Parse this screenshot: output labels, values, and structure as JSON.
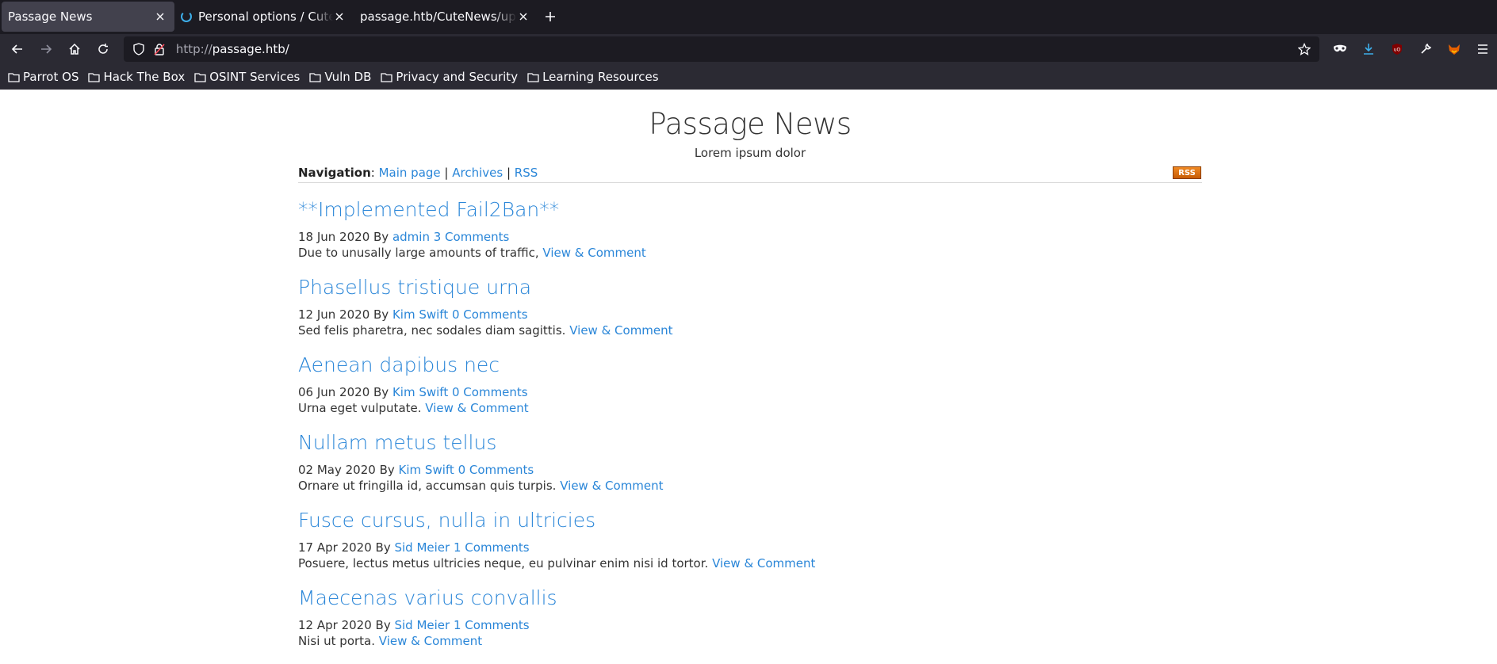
{
  "tabs": [
    {
      "title": "Passage News",
      "active": true
    },
    {
      "title": "Personal options / CuteNews",
      "loading": true
    },
    {
      "title": "passage.htb/CuteNews/uploads"
    }
  ],
  "url": {
    "scheme": "http://",
    "host": "passage.htb/"
  },
  "bookmarks": [
    "Parrot OS",
    "Hack The Box",
    "OSINT Services",
    "Vuln DB",
    "Privacy and Security",
    "Learning Resources"
  ],
  "site": {
    "title": "Passage News",
    "subtitle": "Lorem ipsum dolor"
  },
  "nav": {
    "label": "Navigation",
    "links": [
      "Main page",
      "Archives",
      "RSS"
    ],
    "rss_badge": "RSS"
  },
  "posts": [
    {
      "title": "**Implemented Fail2Ban**",
      "date": "18 Jun 2020",
      "by": "By",
      "author": "admin",
      "comments": "3 Comments",
      "excerpt": "Due to unusally large amounts of traffic,",
      "link": "View & Comment"
    },
    {
      "title": "Phasellus tristique urna",
      "date": "12 Jun 2020",
      "by": "By",
      "author": "Kim Swift",
      "comments": "0 Comments",
      "excerpt": "Sed felis pharetra, nec sodales diam sagittis.",
      "link": "View & Comment"
    },
    {
      "title": "Aenean dapibus nec",
      "date": "06 Jun 2020",
      "by": "By",
      "author": "Kim Swift",
      "comments": "0 Comments",
      "excerpt": "Urna eget vulputate.",
      "link": "View & Comment"
    },
    {
      "title": "Nullam metus tellus",
      "date": "02 May 2020",
      "by": "By",
      "author": "Kim Swift",
      "comments": "0 Comments",
      "excerpt": "Ornare ut fringilla id, accumsan quis turpis.",
      "link": "View & Comment"
    },
    {
      "title": "Fusce cursus, nulla in ultricies",
      "date": "17 Apr 2020",
      "by": "By",
      "author": "Sid Meier",
      "comments": "1 Comments",
      "excerpt": "Posuere, lectus metus ultricies neque, eu pulvinar enim nisi id tortor.",
      "link": "View & Comment"
    },
    {
      "title": "Maecenas varius convallis",
      "date": "12 Apr 2020",
      "by": "By",
      "author": "Sid Meier",
      "comments": "1 Comments",
      "excerpt": "Nisi ut porta.",
      "link": "View & Comment"
    }
  ],
  "colors": {
    "link": "#2a86d8",
    "chrome_dark": "#1c1b22",
    "chrome": "#2b2a33",
    "rss": "#e8770e"
  }
}
